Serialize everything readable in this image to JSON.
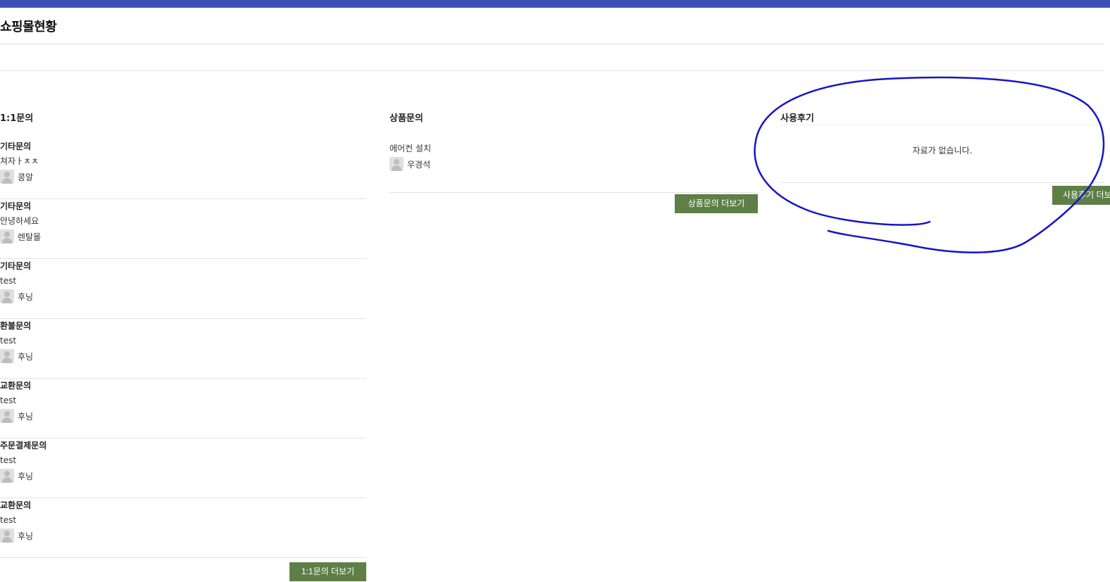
{
  "header": {
    "title": "쇼핑몰현황"
  },
  "qna": {
    "title": "1:1문의",
    "items": [
      {
        "category": "기타문의",
        "subject": "쳐자ㅏㅊㅊ",
        "author": "콩알"
      },
      {
        "category": "기타문의",
        "subject": "안녕하세요",
        "author": "렌탈몰"
      },
      {
        "category": "기타문의",
        "subject": "test",
        "author": "후닝"
      },
      {
        "category": "환불문의",
        "subject": "test",
        "author": "후닝"
      },
      {
        "category": "교환문의",
        "subject": "test",
        "author": "후닝"
      },
      {
        "category": "주문결제문의",
        "subject": "test",
        "author": "후닝"
      },
      {
        "category": "교환문의",
        "subject": "test",
        "author": "후닝"
      }
    ],
    "more_label": "1:1문의 더보기"
  },
  "product_qna": {
    "title": "상품문의",
    "items": [
      {
        "subject": "에어컨 설치",
        "author": "우경석"
      }
    ],
    "more_label": "상품문의 더보기"
  },
  "review": {
    "title": "사용후기",
    "empty_text": "자료가 없습니다.",
    "more_label": "사용후기 더보기"
  },
  "colors": {
    "top_bar": "#3f51b5",
    "button": "#5e7f46",
    "annotation": "#1515c8"
  },
  "icons": {
    "avatar": "default-avatar-icon"
  }
}
